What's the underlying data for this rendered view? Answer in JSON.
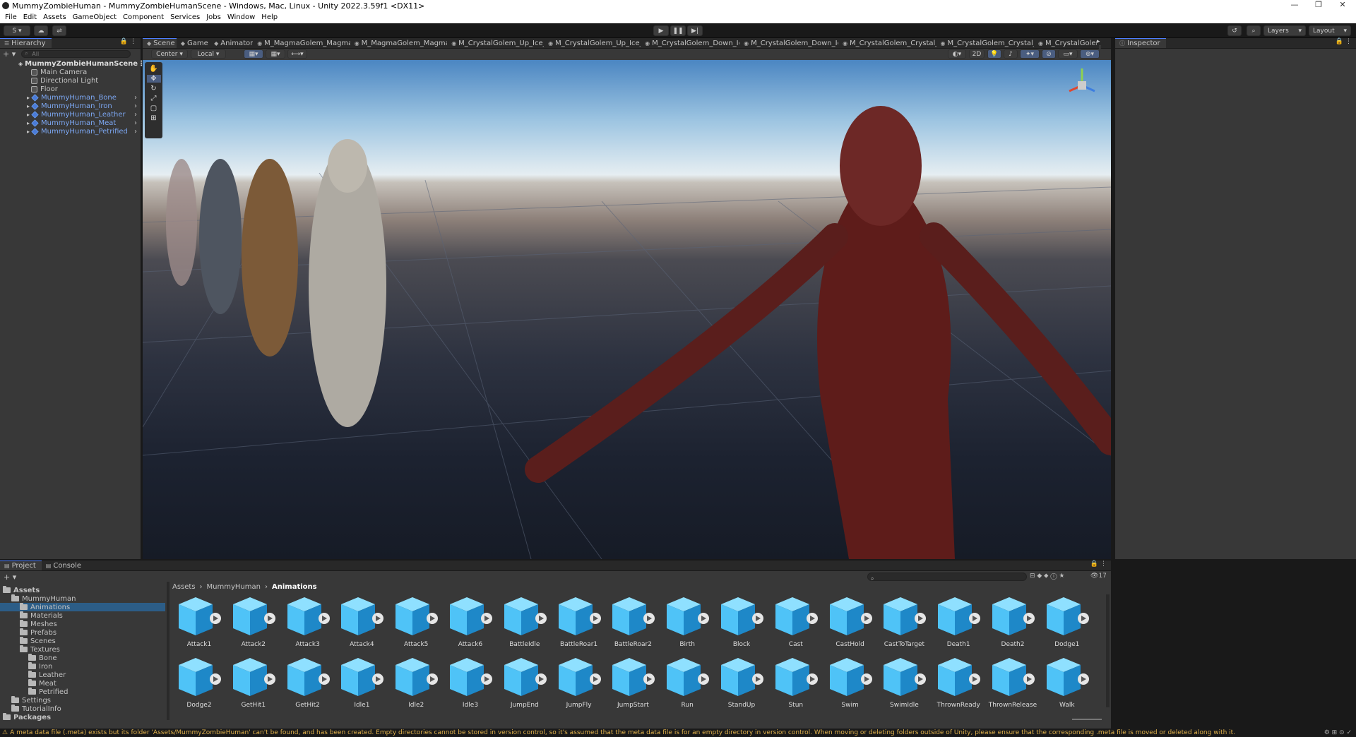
{
  "window": {
    "title": "MummyZombieHuman - MummyZombieHumanScene - Windows, Mac, Linux - Unity 2022.3.59f1 <DX11>",
    "minimize": "—",
    "maximize": "❐",
    "close": "✕"
  },
  "menu": [
    "File",
    "Edit",
    "Assets",
    "GameObject",
    "Component",
    "Services",
    "Jobs",
    "Window",
    "Help"
  ],
  "toolbar": {
    "account": "S",
    "layers": "Layers",
    "layout": "Layout"
  },
  "hierarchy": {
    "tab": "Hierarchy",
    "search_placeholder": "All",
    "scene": "MummyZombieHumanScene",
    "items": [
      {
        "label": "Main Camera",
        "type": "go"
      },
      {
        "label": "Directional Light",
        "type": "go"
      },
      {
        "label": "Floor",
        "type": "go"
      },
      {
        "label": "MummyHuman_Bone",
        "type": "prefab"
      },
      {
        "label": "MummyHuman_Iron",
        "type": "prefab"
      },
      {
        "label": "MummyHuman_Leather",
        "type": "prefab"
      },
      {
        "label": "MummyHuman_Meat",
        "type": "prefab"
      },
      {
        "label": "MummyHuman_Petrified",
        "type": "prefab"
      }
    ]
  },
  "scene_tabs": [
    "Scene",
    "Game",
    "Animator",
    "M_MagmaGolem_Magma...",
    "M_MagmaGolem_Magma...",
    "M_CrystalGolem_Up_Ice_...",
    "M_CrystalGolem_Up_Ice_...",
    "M_CrystalGolem_Down_Ic...",
    "M_CrystalGolem_Down_Ic...",
    "M_CrystalGolem_Crystal_...",
    "M_CrystalGolem_Crystal_...",
    "M_CrystalGolen"
  ],
  "scene_toolbar": {
    "pivot": "Center",
    "space": "Local",
    "mode2d": "2D"
  },
  "inspector": {
    "tab": "Inspector"
  },
  "project": {
    "tabs": [
      "Project",
      "Console"
    ],
    "item_count": "17",
    "breadcrumb": [
      "Assets",
      "MummyHuman",
      "Animations"
    ],
    "tree": [
      {
        "label": "Assets",
        "level": 0,
        "bold": true
      },
      {
        "label": "MummyHuman",
        "level": 1
      },
      {
        "label": "Animations",
        "level": 2,
        "selected": true
      },
      {
        "label": "Materials",
        "level": 2
      },
      {
        "label": "Meshes",
        "level": 2
      },
      {
        "label": "Prefabs",
        "level": 2
      },
      {
        "label": "Scenes",
        "level": 2
      },
      {
        "label": "Textures",
        "level": 2
      },
      {
        "label": "Bone",
        "level": 3
      },
      {
        "label": "Iron",
        "level": 3
      },
      {
        "label": "Leather",
        "level": 3
      },
      {
        "label": "Meat",
        "level": 3
      },
      {
        "label": "Petrified",
        "level": 3
      },
      {
        "label": "Settings",
        "level": 1
      },
      {
        "label": "TutorialInfo",
        "level": 1
      },
      {
        "label": "Packages",
        "level": 0,
        "bold": true
      }
    ],
    "assets_row1": [
      "Attack1",
      "Attack2",
      "Attack3",
      "Attack4",
      "Attack5",
      "Attack6",
      "BattleIdle",
      "BattleRoar1",
      "BattleRoar2",
      "Birth",
      "Block",
      "Cast",
      "CastHold",
      "CastToTarget",
      "Death1",
      "Death2",
      "Dodge1"
    ],
    "assets_row2": [
      "Dodge2",
      "GetHit1",
      "GetHit2",
      "Idle1",
      "Idle2",
      "Idle3",
      "JumpEnd",
      "JumpFly",
      "JumpStart",
      "Run",
      "StandUp",
      "Stun",
      "Swim",
      "SwimIdle",
      "ThrownReady",
      "ThrownRelease",
      "Walk"
    ]
  },
  "status": {
    "message": "A meta data file (.meta) exists but its folder 'Assets/MummyZombieHuman' can't be found, and has been created. Empty directories cannot be stored in version control, so it's assumed that the meta data file is for an empty directory in version control. When moving or deleting folders outside of Unity, please ensure that the corresponding .meta file is moved or deleted along with it."
  },
  "colors": {
    "accent": "#4c7eff",
    "prefab_text": "#7ca7f2",
    "asset_icon": "#4fc3f7",
    "warning": "#e0b14c"
  }
}
